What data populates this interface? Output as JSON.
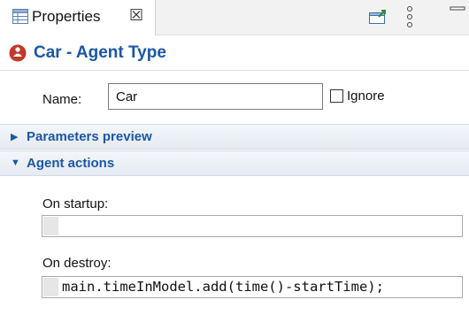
{
  "tab": {
    "label": "Properties",
    "icon": "properties-view-icon",
    "close_icon": "close-icon"
  },
  "toolbar": {
    "icons": [
      "new-window-icon",
      "view-menu-icon",
      "minimize-icon"
    ]
  },
  "header": {
    "title": "Car - Agent Type",
    "icon": "agent-type-icon",
    "icon_color": "#c0392b",
    "title_color": "#1b57a3"
  },
  "form": {
    "name_label": "Name:",
    "name_value": "Car",
    "ignore_label": "Ignore",
    "ignore_checked": false
  },
  "sections": {
    "parameters_preview": {
      "label": "Parameters preview",
      "expanded": false
    },
    "agent_actions": {
      "label": "Agent actions",
      "expanded": true
    }
  },
  "fields": {
    "on_startup": {
      "label": "On startup:",
      "code": ""
    },
    "on_destroy": {
      "label": "On destroy:",
      "code": "main.timeInModel.add(time()-startTime);"
    }
  }
}
